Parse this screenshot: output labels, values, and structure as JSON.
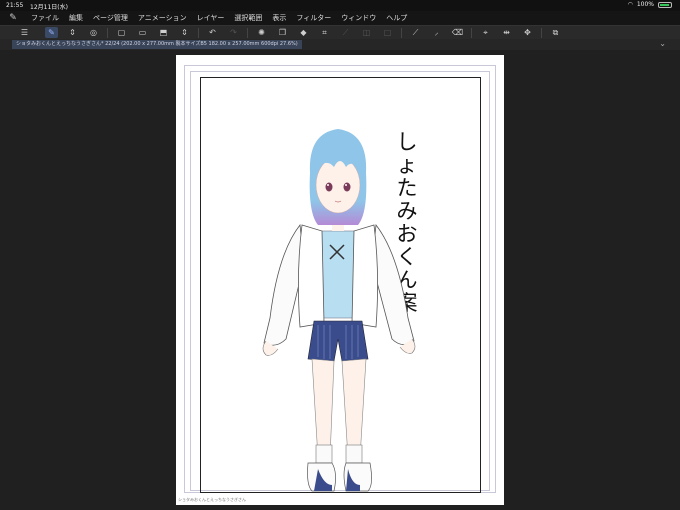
{
  "status_bar": {
    "time": "21:55",
    "date": "12月11日(水)",
    "battery": "100%"
  },
  "menu": {
    "items": [
      "ファイル",
      "編集",
      "ページ管理",
      "アニメーション",
      "レイヤー",
      "選択範囲",
      "表示",
      "フィルター",
      "ウィンドウ",
      "ヘルプ"
    ]
  },
  "tab": {
    "title": "ショタみおくんとえっちなうさぎさん* 22/24 (202.00 x 277.00mm 製本サイズB5 182.00 x 257.00mm 600dpi 27.6%)"
  },
  "canvas": {
    "title_text": "しょたみおくん案",
    "footer_note": "ショタみおくんとえっちなうさぎさん"
  },
  "colors": {
    "hair": "#8ec5e8",
    "hair_tips": "#b48ad6",
    "shirt": "#b8def2",
    "shorts": "#3a4c8c",
    "accent_tab": "#3a4458"
  }
}
